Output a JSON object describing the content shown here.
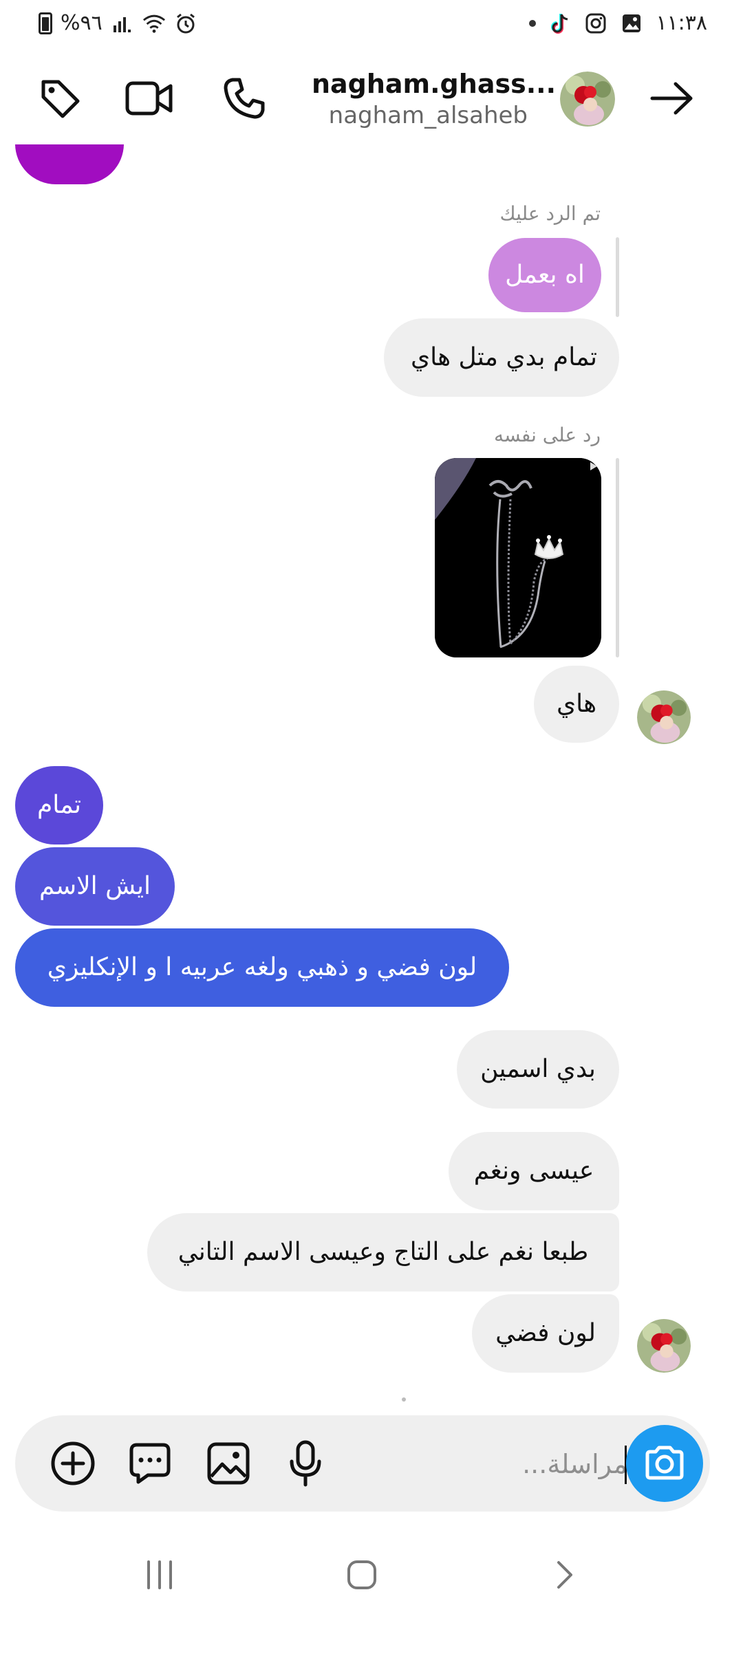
{
  "status_bar": {
    "time": "١١:٣٨",
    "battery_text": "%٩٦"
  },
  "header": {
    "display_name": "nagham.ghass...",
    "username": "nagham_alsaheb"
  },
  "messages": {
    "reply_note_1": "تم الرد عليك",
    "reply_quote_1": "اه بعمل",
    "m1": "تمام بدي متل هاي",
    "reply_note_2": "رد على نفسه",
    "m2": "هاي",
    "o1": "تمام",
    "o2": "ايش الاسم",
    "o3": "لون فضي و ذهبي ولغه عربيه ا و الإنكليزي",
    "m3": "بدي اسمين",
    "m4": "عيسى ونغم",
    "m5": "طبعا نغم على التاج وعيسى الاسم التاني",
    "m6": "لون فضي"
  },
  "composer": {
    "placeholder": "مراسلة..."
  },
  "colors": {
    "accent_blue": "#1d9bf0",
    "out_purple": "#a10dc0",
    "reply_purple": "#cc88e0",
    "out_gradient_top": "#5b48d9",
    "out_gradient_bottom": "#3f5fe0",
    "incoming_bg": "#efefef"
  },
  "icons": {
    "header": [
      "tag-icon",
      "video-call-icon",
      "phone-icon",
      "back-arrow-icon"
    ],
    "composer": [
      "add-icon",
      "sticker-chat-icon",
      "gallery-icon",
      "microphone-icon",
      "camera-icon"
    ],
    "nav": [
      "recent-apps-icon",
      "home-icon",
      "back-icon"
    ]
  }
}
